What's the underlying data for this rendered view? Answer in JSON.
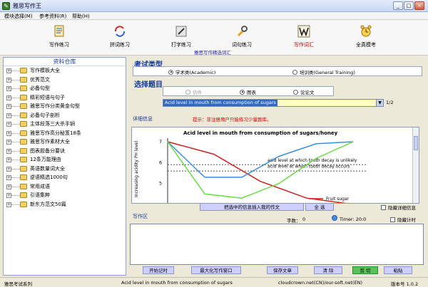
{
  "window": {
    "title": "雅思写作王",
    "min": "_",
    "max": "□",
    "close": "×"
  },
  "menu": [
    "模块选择(M)",
    "参考资料(R)",
    "帮助(H)"
  ],
  "toolbar": {
    "tools": [
      {
        "label": "写作练习",
        "icon": "notebook-icon"
      },
      {
        "label": "拼词练习",
        "icon": "refresh-arrows-icon"
      },
      {
        "label": "打字练习",
        "icon": "pen-tool-icon"
      },
      {
        "label": "词句练习",
        "icon": "wrench-icon"
      },
      {
        "label": "写作词汇",
        "icon": "vocabulary-w-icon"
      },
      {
        "label": "全真模考",
        "icon": "alarm-clock-icon"
      }
    ],
    "hint": "雅思写作精选词汇"
  },
  "sidebar": {
    "title": "资料仓库",
    "items": [
      "写作模板大全",
      "优秀范文",
      "必备句型",
      "精彩短语与句子",
      "雅思写作分类黄金句型",
      "必备句子剖析",
      "主体段落三大杀手锏",
      "雅思写作高分秘笈18条",
      "雅思写作素材大全",
      "图表题备分要诀",
      "12条万能理由",
      "英语数量词大全",
      "逆语精选1000句",
      "常用成语",
      "引语集粹",
      "新东方范文50篇"
    ]
  },
  "main": {
    "exam_type_title": "考试类型",
    "exam_types": [
      "学术类(Academic)",
      "培训类(General Training)"
    ],
    "select_title": "选择题目",
    "topic_types": [
      "信件",
      "图表",
      "论论文"
    ],
    "selected_topic": "Acid level in mouth from consumption of sugars",
    "pager": "1/2",
    "details_label": "详细信息",
    "hint": "提示：非注册用户只能练习少量题库。",
    "insert_button": "把选中的信息插入我的作文",
    "select_all_button": "全 选",
    "hide_details": "隐藏详细信息",
    "writing_label": "写作区",
    "word_count_label": "字数：",
    "word_count": "0",
    "timer": "Timer: 20:0",
    "hide_timer": "隐藏计时",
    "buttons": [
      "开始记时",
      "最大化写作窗口",
      "保存文章",
      "清 除",
      "剪 切",
      "粘贴"
    ]
  },
  "status": {
    "left": "雅思考试系列",
    "topic": "Acid level in mouth from consumption of sugars",
    "site": "cloudcrown.net(CN)/our-soft.net(EN)",
    "version": "版本号 1.0.2"
  },
  "chart_data": {
    "type": "line",
    "title": "Acid level in mouth from consumption of sugars/honey",
    "ylabel": "Increasing acidity     PH level",
    "yticks": [
      "7",
      "6",
      "5"
    ],
    "annotations": [
      "acid level at which tooth decay is unlikely",
      "acid level at which tooth decay occurs"
    ],
    "legend": [
      "Fruit sugar"
    ],
    "series": [
      {
        "color": "#d02020",
        "values": [
          7,
          6.4,
          5.1,
          4.3,
          4.0
        ]
      },
      {
        "color": "#3a8fe0",
        "values": [
          7,
          5.3,
          5.3,
          6.3,
          6.9,
          7.0
        ]
      },
      {
        "color": "#66dd44",
        "values": [
          7,
          4.5,
          4.3,
          5.0,
          6.2,
          7.0
        ]
      }
    ]
  }
}
